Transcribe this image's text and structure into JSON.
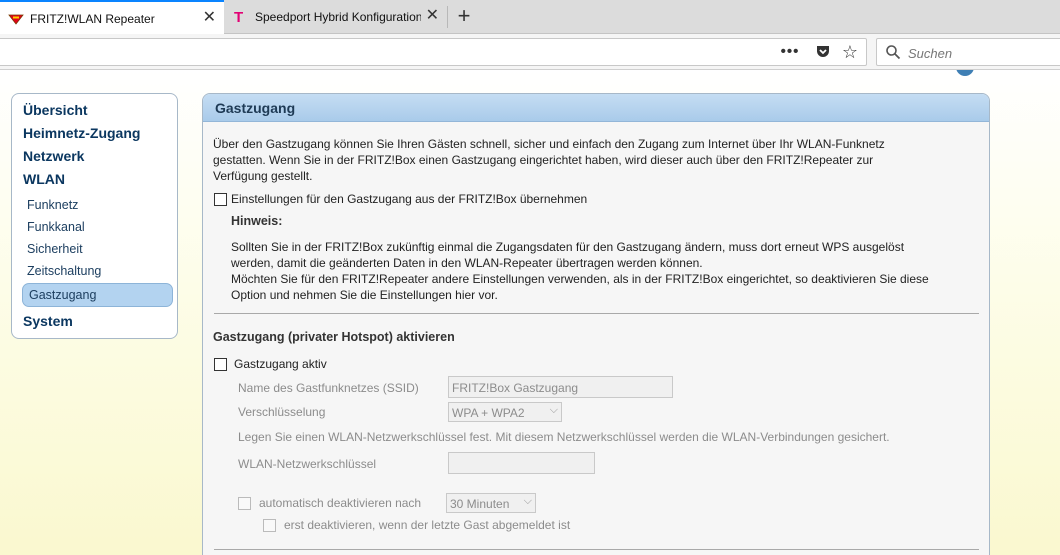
{
  "browser": {
    "tabs": [
      {
        "title": "FRITZ!WLAN Repeater",
        "active": true
      },
      {
        "title": "Speedport Hybrid Konfiguration",
        "active": false
      }
    ],
    "search_placeholder": "Suchen",
    "accent_color": "#0a84ff"
  },
  "menu": {
    "items": [
      {
        "label": "Übersicht",
        "level": "top"
      },
      {
        "label": "Heimnetz-Zugang",
        "level": "top"
      },
      {
        "label": "Netzwerk",
        "level": "top"
      },
      {
        "label": "WLAN",
        "level": "top"
      },
      {
        "label": "Funknetz",
        "level": "sub"
      },
      {
        "label": "Funkkanal",
        "level": "sub"
      },
      {
        "label": "Sicherheit",
        "level": "sub"
      },
      {
        "label": "Zeitschaltung",
        "level": "sub"
      },
      {
        "label": "Gastzugang",
        "level": "sub",
        "selected": true
      },
      {
        "label": "System",
        "level": "top"
      }
    ]
  },
  "panel": {
    "title": "Gastzugang",
    "intro_lines": [
      "Über den Gastzugang können Sie Ihren Gästen schnell, sicher und einfach den Zugang zum Internet über Ihr WLAN-Funknetz",
      "gestatten. Wenn Sie in der FRITZ!Box einen Gastzugang eingerichtet haben, wird dieser auch über den FRITZ!Repeater zur",
      "Verfügung gestellt."
    ],
    "adopt_checkbox_label": "Einstellungen für den Gastzugang aus der FRITZ!Box übernehmen",
    "hint_title": "Hinweis:",
    "hint_lines": [
      "Sollten Sie in der FRITZ!Box zukünftig einmal die Zugangsdaten für den Gastzugang ändern, muss dort erneut WPS ausgelöst",
      "werden, damit die geänderten Daten in den WLAN-Repeater übertragen werden können.",
      "Möchten Sie für den FRITZ!Repeater andere Einstellungen verwenden, als in der FRITZ!Box eingerichtet, so deaktivieren Sie diese",
      "Option und nehmen Sie die Einstellungen hier vor."
    ],
    "section_title": "Gastzugang (privater Hotspot) aktivieren",
    "active_checkbox_label": "Gastzugang aktiv",
    "ssid_label": "Name des Gastfunknetzes (SSID)",
    "ssid_value": "FRITZ!Box Gastzugang",
    "encryption_label": "Verschlüsselung",
    "encryption_value": "WPA + WPA2",
    "key_info": "Legen Sie einen WLAN-Netzwerkschlüssel fest. Mit diesem Netzwerkschlüssel werden die WLAN-Verbindungen gesichert.",
    "key_label": "WLAN-Netzwerkschlüssel",
    "key_value": "",
    "auto_off_label": "automatisch deaktivieren nach",
    "auto_off_value": "30 Minuten",
    "last_guest_label": "erst deaktivieren, wenn der letzte Gast abgemeldet ist"
  }
}
